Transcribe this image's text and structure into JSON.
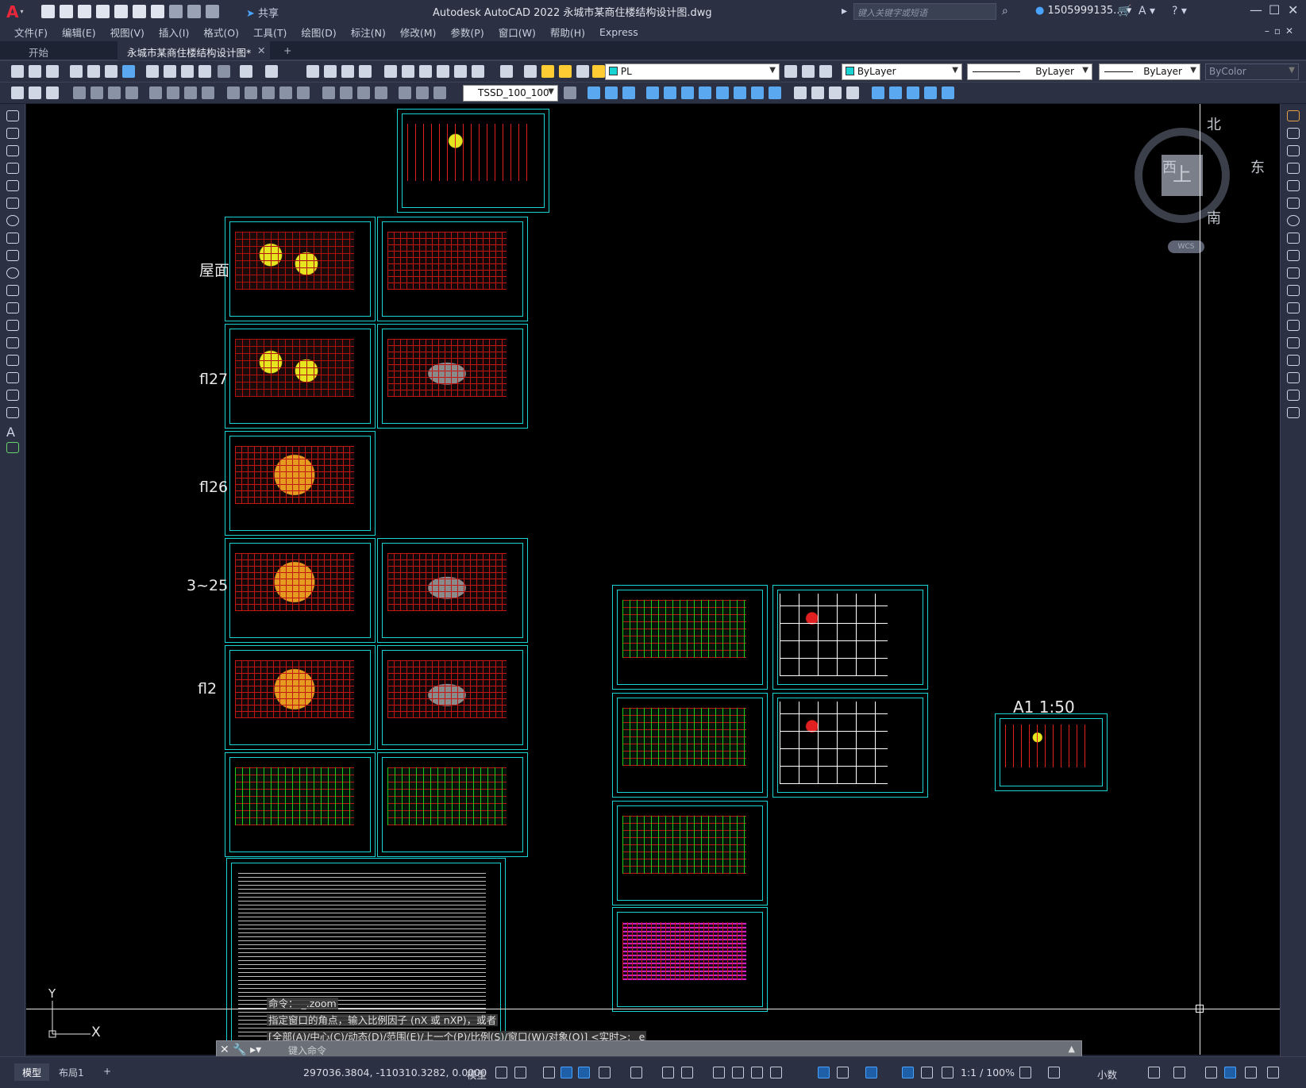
{
  "window": {
    "title": "Autodesk AutoCAD 2022    永城市某商住楼结构设计图.dwg",
    "share_label": "共享",
    "search_placeholder": "键入关键字或短语",
    "user": "1505999135...",
    "controls": [
      "—",
      "☐",
      "✕"
    ]
  },
  "menu": [
    "文件(F)",
    "编辑(E)",
    "视图(V)",
    "插入(I)",
    "格式(O)",
    "工具(T)",
    "绘图(D)",
    "标注(N)",
    "修改(M)",
    "参数(P)",
    "窗口(W)",
    "帮助(H)",
    "Express"
  ],
  "tabs": {
    "start": "开始",
    "doc": "永城市某商住楼结构设计图*",
    "close": "✕",
    "add": "+"
  },
  "toolbar": {
    "layer": "PL",
    "color": "ByLayer",
    "linetype": "ByLayer",
    "lineweight": "ByLayer",
    "plotstyle": "ByColor",
    "dimstyle": "TSSD_100_100"
  },
  "viewcube": {
    "north": "北",
    "south": "南",
    "east": "东",
    "west": "西",
    "top": "上",
    "wcs": "WCS"
  },
  "drawing": {
    "floor_labels": [
      "屋面",
      "fl27",
      "fl26",
      "3~25",
      "fl2"
    ],
    "scale_label": "A1 1:50"
  },
  "ucs": {
    "x": "X",
    "y": "Y"
  },
  "command": {
    "history": [
      "命令： _.zoom",
      "指定窗口的角点，输入比例因子 (nX 或 nXP)，或者",
      "[全部(A)/中心(C)/动态(D)/范围(E)/上一个(P)/比例(S)/窗口(W)/对象(O)] <实时>: _e"
    ],
    "placeholder": "键入命令"
  },
  "status": {
    "layouts": [
      "模型",
      "布局1",
      "+"
    ],
    "coords": "297036.3804, -110310.3282, 0.0000",
    "model": "模型",
    "scale": "1:1 / 100%",
    "units": "小数"
  },
  "colors": {
    "accent": "#19d3d3",
    "bg": "#000000",
    "chrome": "#2b3142"
  }
}
